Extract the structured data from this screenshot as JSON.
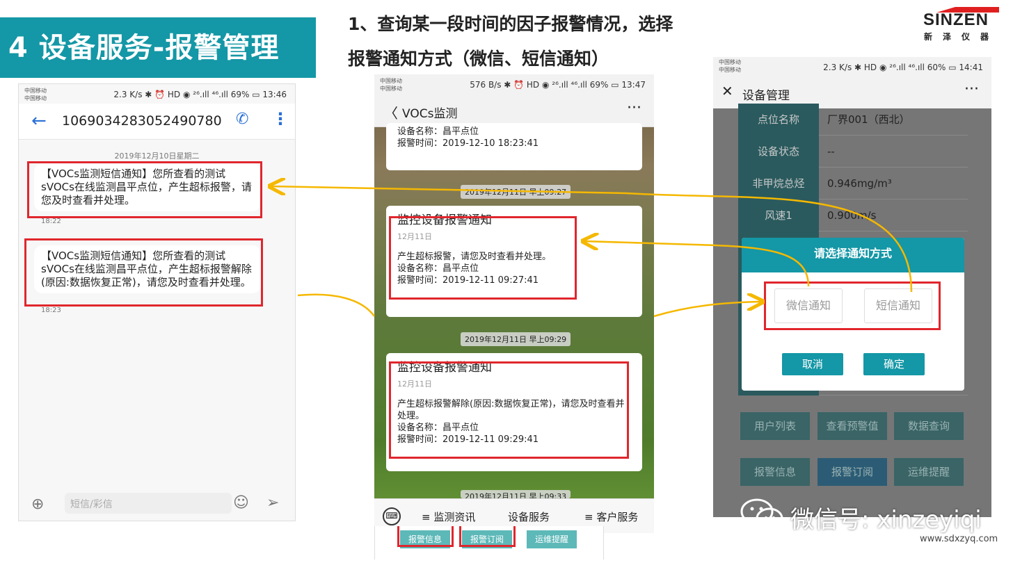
{
  "slide": {
    "title": "4 设备服务-报警管理",
    "heading_line1": "1、查询某一段时间的因子报警情况，选择",
    "heading_line2": "报警通知方式（微信、短信通知）",
    "logo_name": "SINZEN",
    "logo_sub": "新泽仪器",
    "accent_color": "#1497a6",
    "highlight_color": "#e0262d",
    "arrow_color": "#f5b800",
    "watermark": "微信号: xinzeyiqi",
    "website": "www.sdxzyq.com"
  },
  "phone1": {
    "carrier": "中国移动\n中国移动",
    "status": "2.3 K/s ✱ ⏰ HD ◉ ²⁶.ıll ⁴⁶.ıll 69% ▭ 13:46",
    "number": "1069034283052490780",
    "back_icon": "←",
    "call_icon": "✆",
    "more_icon": "⋮",
    "date": "2019年12月10日星期二",
    "messages": [
      {
        "text": "【VOCs监测短信通知】您所查看的测试sVOCs在线监测昌平点位，产生超标报警，请您及时查看并处理。",
        "time": "18:22"
      },
      {
        "text": "【VOCs监测短信通知】您所查看的测试sVOCs在线监测昌平点位，产生超标报警解除(原因:数据恢复正常)，请您及时查看并处理。",
        "time": "18:23"
      }
    ],
    "input_placeholder": "短信/彩信"
  },
  "phone2": {
    "carrier": "中国移动\n中国移动",
    "status": "576 B/s ✱ ⏰ HD ◉ ²⁶.ıll ⁴⁶.ıll 69% ▭ 13:47",
    "title": "VOCs监测",
    "partial_card": {
      "device": "设备名称：昌平点位",
      "time": "报警时间：2019-12-10 18:23:41"
    },
    "timestamps": [
      "2019年12月11日 早上09:27",
      "2019年12月11日 早上09:29",
      "2019年12月11日 早上09:33"
    ],
    "cards": [
      {
        "title": "监控设备报警通知",
        "date": "12月11日",
        "body": "产生超标报警，请您及时查看并处理。",
        "device": "设备名称：昌平点位",
        "time": "报警时间：2019-12-11 09:27:41"
      },
      {
        "title": "监控设备报警通知",
        "date": "12月11日",
        "body": "产生超标报警解除(原因:数据恢复正常)，请您及时查看并处理。",
        "device": "设备名称：昌平点位",
        "time": "报警时间：2019-12-11 09:29:41"
      }
    ],
    "tabs": [
      "≡ 监测资讯",
      "设备服务",
      "≡ 客户服务"
    ],
    "below_buttons": [
      "报警信息",
      "报警订阅",
      "运维提醒"
    ]
  },
  "phone3": {
    "carrier": "中国移动\n中国移动",
    "status": "2.3 K/s ✱ HD ◉ ²⁶.ıll ⁴⁶.ıll 60% ▭ 14:41",
    "title": "设备管理",
    "rows": [
      {
        "label": "点位名称",
        "value": "厂界001（西北）"
      },
      {
        "label": "设备状态",
        "value": "--"
      },
      {
        "label": "非甲烷总烃",
        "value": "0.946mg/m³"
      },
      {
        "label": "风速1",
        "value": "0.900m/s"
      }
    ],
    "dialog": {
      "title": "请选择通知方式",
      "options": [
        "微信通知",
        "短信通知"
      ],
      "cancel": "取消",
      "confirm": "确定"
    },
    "buttons_row1": [
      "用户列表",
      "查看预警值",
      "数据查询"
    ],
    "buttons_row2": [
      "报警信息",
      "报警订阅",
      "运维提醒"
    ]
  }
}
